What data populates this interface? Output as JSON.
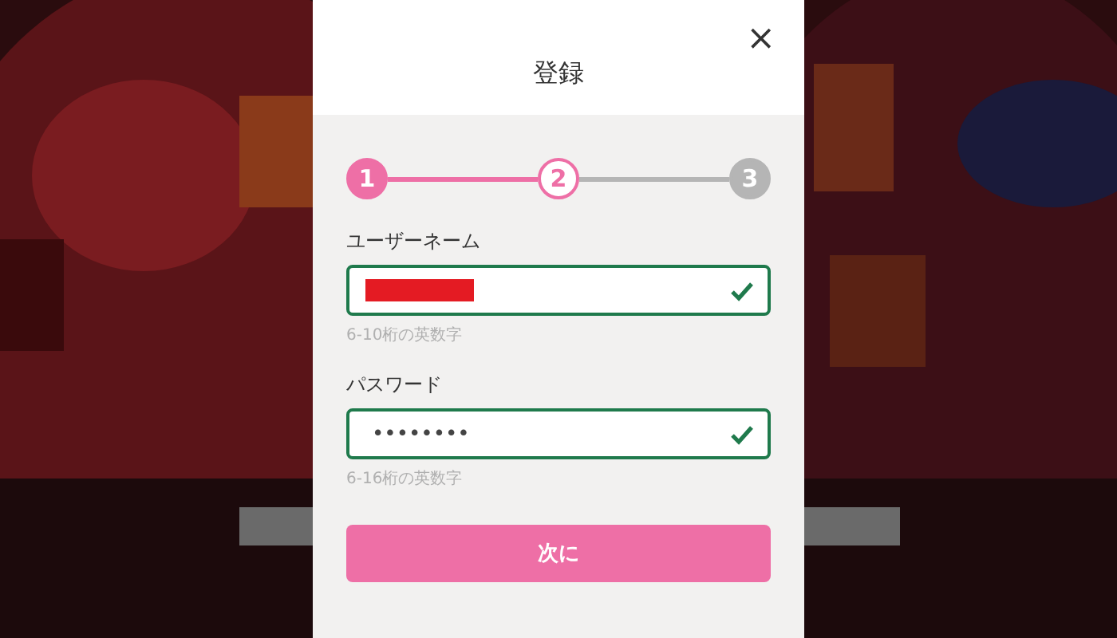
{
  "dialog": {
    "title": "登録",
    "close": "×",
    "steps": [
      {
        "label": "1",
        "completed": true,
        "selected": false
      },
      {
        "label": "2",
        "completed": false,
        "selected": true
      },
      {
        "label": "3",
        "completed": false,
        "selected": false
      }
    ],
    "fields": [
      {
        "label": "ユーザーネーム",
        "redacted": true,
        "valid": true,
        "hint": "6-10桁の英数字"
      },
      {
        "label": "パスワード",
        "value": "••••••••",
        "valid": true,
        "hint": "6-16桁の英数字"
      }
    ],
    "submit": "次に"
  }
}
